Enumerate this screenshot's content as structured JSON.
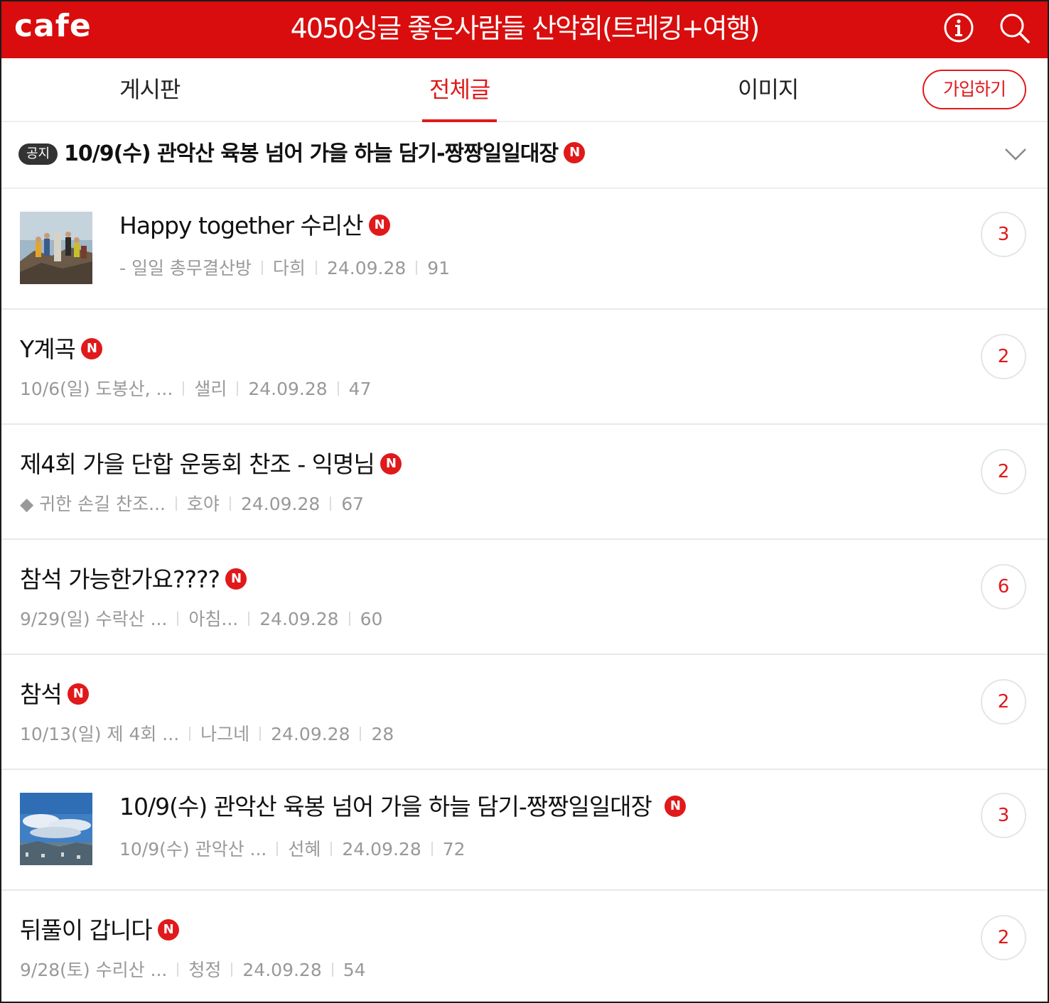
{
  "header": {
    "logo": "cafe",
    "title": "4050싱글 좋은사람들 산악회(트레킹+여행)",
    "bg_color": "#d90d0d"
  },
  "tabs": [
    {
      "label": "게시판",
      "active": false
    },
    {
      "label": "전체글",
      "active": true
    },
    {
      "label": "이미지",
      "active": false
    }
  ],
  "join_label": "가입하기",
  "accent_color": "#e0191b",
  "notice": {
    "badge": "공지",
    "title": "10/9(수) 관악산 육봉 넘어 가을 하늘 담기-짱짱일일대장",
    "new_badge": "N"
  },
  "posts": [
    {
      "title": "Happy together 수리산",
      "new_badge": "N",
      "board": "- 일일 총무결산방",
      "author": "다희",
      "date": "24.09.28",
      "views": "91",
      "comments": "3",
      "thumbnail": "mountain-summit-group-photo"
    },
    {
      "title": "Y계곡",
      "new_badge": "N",
      "board": "10/6(일) 도봉산, ...",
      "author": "샐리",
      "date": "24.09.28",
      "views": "47",
      "comments": "2"
    },
    {
      "title": "제4회 가을 단합 운동회 찬조 - 익명님",
      "new_badge": "N",
      "board": "◆ 귀한 손길 찬조...",
      "author": "호야",
      "date": "24.09.28",
      "views": "67",
      "comments": "2"
    },
    {
      "title": "참석 가능한가요????",
      "new_badge": "N",
      "board": "9/29(일) 수락산 ...",
      "author": "아침...",
      "date": "24.09.28",
      "views": "60",
      "comments": "6"
    },
    {
      "title": "참석",
      "new_badge": "N",
      "board": "10/13(일) 제 4회 ...",
      "author": "나그네",
      "date": "24.09.28",
      "views": "28",
      "comments": "2"
    },
    {
      "title": "10/9(수) 관악산 육봉 넘어 가을 하늘 담기-짱짱일일대장",
      "new_badge": "N",
      "board": "10/9(수) 관악산 ...",
      "author": "선혜",
      "date": "24.09.28",
      "views": "72",
      "comments": "3",
      "thumbnail": "sky-city-view-photo"
    },
    {
      "title": "뒤풀이 갑니다",
      "new_badge": "N",
      "board": "9/28(토) 수리산 ...",
      "author": "청정",
      "date": "24.09.28",
      "views": "54",
      "comments": "2"
    }
  ]
}
